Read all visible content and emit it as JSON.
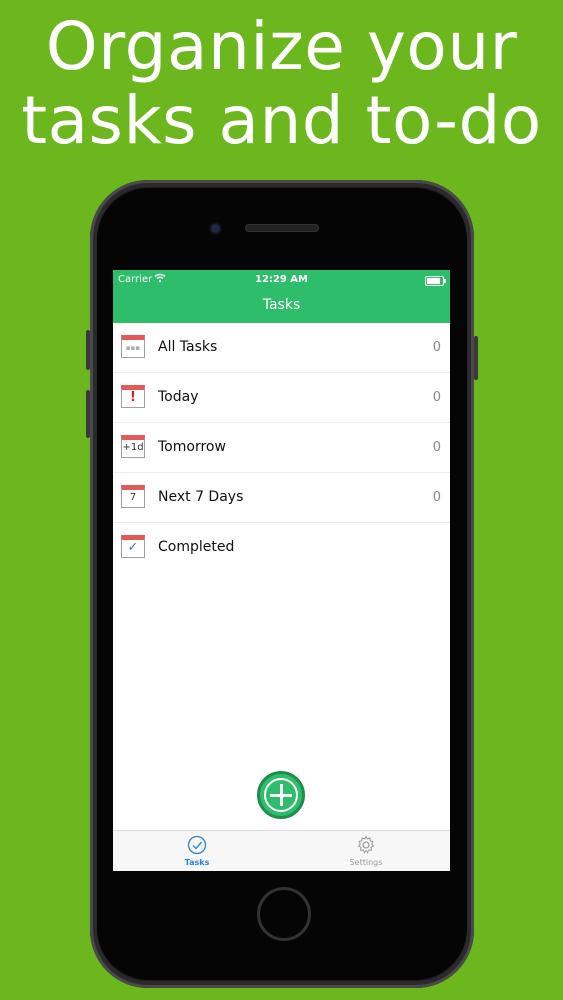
{
  "headline": {
    "line1": "Organize your",
    "line2": "tasks and to-do"
  },
  "status_bar": {
    "carrier": "Carrier",
    "time": "12:29 AM"
  },
  "nav": {
    "title": "Tasks"
  },
  "lists": [
    {
      "label": "All Tasks",
      "count": "0",
      "icon": "calendar-grid-icon",
      "glyph": "▪▪▪"
    },
    {
      "label": "Today",
      "count": "0",
      "icon": "calendar-exclamation-icon",
      "glyph": "!"
    },
    {
      "label": "Tomorrow",
      "count": "0",
      "icon": "calendar-plus-one-icon",
      "glyph": "+1d"
    },
    {
      "label": "Next 7 Days",
      "count": "0",
      "icon": "calendar-seven-icon",
      "glyph": "7"
    },
    {
      "label": "Completed",
      "count": "",
      "icon": "calendar-check-icon",
      "glyph": "✓"
    }
  ],
  "tabs": [
    {
      "label": "Tasks",
      "icon": "checkmark-circle-icon",
      "active": true
    },
    {
      "label": "Settings",
      "icon": "gear-icon",
      "active": false
    }
  ],
  "colors": {
    "background": "#6db71e",
    "nav_green": "#2ebd6b",
    "tab_active": "#2a86d8",
    "calendar_red": "#e15a5a"
  }
}
